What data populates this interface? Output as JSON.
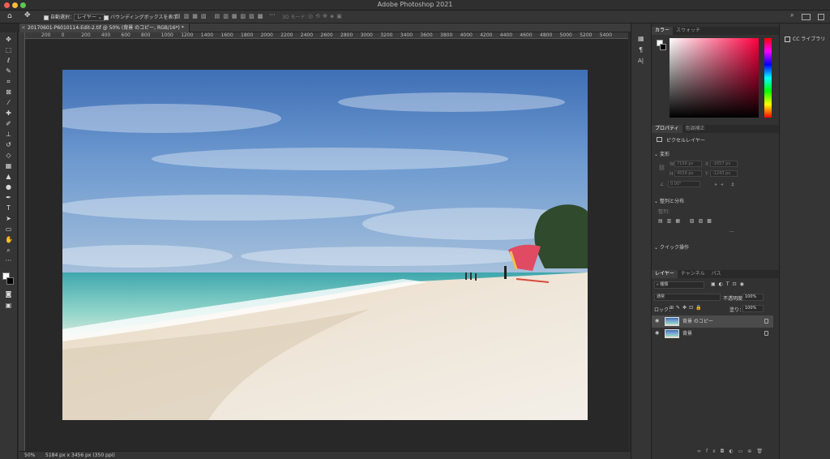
{
  "window": {
    "title": "Adobe Photoshop 2021"
  },
  "options_bar": {
    "auto_select_label": "自動選択：",
    "auto_select_value": "レイヤー",
    "bbox_label": "バウンディングボックスを表示",
    "mode3d_label": "3D モード："
  },
  "document_tab": {
    "title": "20170601-P6010114-Edit-2.tif @ 50% (背景 のコピー, RGB/16*) *"
  },
  "ruler": {
    "ticks": [
      "200",
      "0",
      "200",
      "400",
      "600",
      "800",
      "1000",
      "1200",
      "1400",
      "1600",
      "1800",
      "2000",
      "2200",
      "2400",
      "2600",
      "2800",
      "3000",
      "3200",
      "3400",
      "3600",
      "3800",
      "4000",
      "4200",
      "4400",
      "4600",
      "4800",
      "5000",
      "5200",
      "5400"
    ]
  },
  "status": {
    "zoom": "50%",
    "doc_info": "5184 px x 3456 px (350 ppi)"
  },
  "color_panel": {
    "tabs": [
      "カラー",
      "スウォッチ"
    ]
  },
  "properties_panel": {
    "tabs": [
      "プロパティ",
      "色調補正"
    ],
    "layer_type": "ピクセルレイヤー",
    "transform_label": "変形",
    "w_label": "W",
    "w_value": "7159 px",
    "x_label": "X",
    "x_value": "-1657 px",
    "h_label": "H",
    "h_value": "4559 px",
    "y_label": "Y",
    "y_value": "-1243 px",
    "angle_value": "0.00°",
    "align_label": "整列と分布",
    "align_sub": "整列：",
    "quick_label": "クイック操作"
  },
  "layers_panel": {
    "tabs": [
      "レイヤー",
      "チャンネル",
      "パス"
    ],
    "filter": "種類",
    "blend_mode": "通常",
    "opacity_label": "不透明度：",
    "opacity_value": "100%",
    "lock_label": "ロック：",
    "fill_label": "塗り：",
    "fill_value": "100%",
    "layers": [
      {
        "name": "背景 のコピー",
        "selected": true
      },
      {
        "name": "背景",
        "selected": false
      }
    ]
  },
  "libraries": {
    "label": "CC ライブラリ"
  },
  "colors": {
    "accent": "#3b8eea",
    "selected_layer": "#4b4b4b"
  }
}
